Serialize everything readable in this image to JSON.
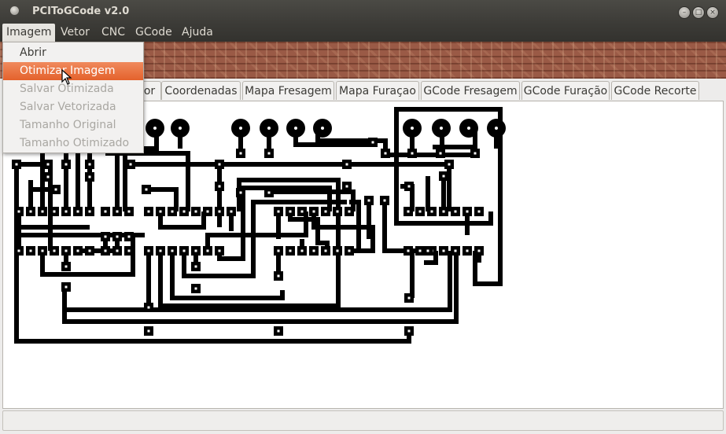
{
  "window": {
    "title": "PCIToGCode  v2.0"
  },
  "menubar": {
    "items": [
      {
        "label": "Imagem",
        "active": true
      },
      {
        "label": "Vetor"
      },
      {
        "label": "CNC"
      },
      {
        "label": "GCode"
      },
      {
        "label": "Ajuda"
      }
    ]
  },
  "dropdown": {
    "items": [
      {
        "label": "Abrir",
        "enabled": true
      },
      {
        "label": "Otimizar Imagem",
        "enabled": true,
        "highlighted": true
      },
      {
        "label": "Salvar Otimizada",
        "enabled": false
      },
      {
        "label": "Salvar Vetorizada",
        "enabled": false
      },
      {
        "label": "Tamanho Original",
        "enabled": false
      },
      {
        "label": "Tamanho Otimizado",
        "enabled": false
      }
    ]
  },
  "tabs": [
    {
      "label": "or"
    },
    {
      "label": "Coordenadas"
    },
    {
      "label": "Mapa Fresagem"
    },
    {
      "label": "Mapa Furaçao"
    },
    {
      "label": "GCode Fresagem"
    },
    {
      "label": "GCode Furação"
    },
    {
      "label": "GCode Recorte"
    }
  ],
  "colors": {
    "menu_highlight": "#e8672f",
    "titlebar": "#3c3b37",
    "trace": "#000000"
  }
}
